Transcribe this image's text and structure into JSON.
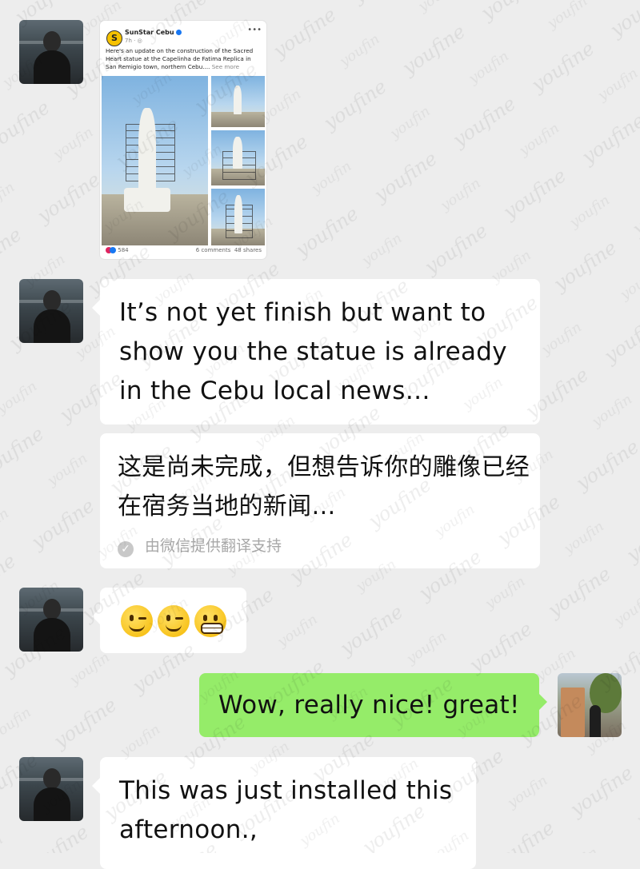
{
  "messages": [
    {
      "type": "shared_post",
      "post": {
        "source_name": "SunStar Cebu",
        "logo_letter": "S",
        "time": "7h ·",
        "caption": "Here's an update on the construction of the Sacred Heart statue at the Capelinha de Fatima Replica in San Remigio town, northern Cebu....",
        "see_more": "See more",
        "reaction_count": "584",
        "comments": "6 comments",
        "shares": "48 shares"
      }
    },
    {
      "type": "text",
      "text": "It’s not yet finish but want to show you the statue is already in the Cebu local news…",
      "translation": "这是尚未完成，但想告诉你的雕像已经在宿务当地的新闻…",
      "translation_note": "由微信提供翻译支持"
    },
    {
      "type": "emoji",
      "emojis": [
        "winking-face",
        "winking-face",
        "grimacing-face"
      ]
    },
    {
      "type": "text",
      "text": "Wow, really nice! great!"
    },
    {
      "type": "text",
      "text": "This was just installed this afternoon.,"
    }
  ],
  "watermark": "youfine",
  "colors": {
    "background": "#ededed",
    "incoming_bubble": "#ffffff",
    "outgoing_bubble": "#95ec69"
  }
}
